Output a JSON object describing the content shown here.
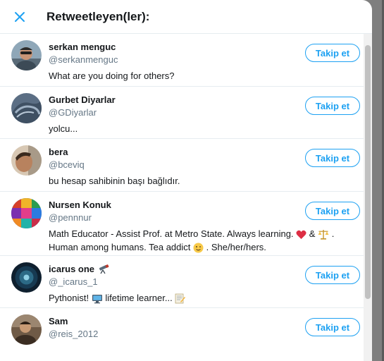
{
  "modal": {
    "title": "Retweetleyen(ler):",
    "close_icon": "close-icon",
    "accent_color": "#1da1f2"
  },
  "users": [
    {
      "name": "serkan menguc",
      "handle": "@serkanmenguc",
      "bio": "What are you doing for others?",
      "follow_label": "Takip et"
    },
    {
      "name": "Gurbet Diyarlar",
      "handle": "@GDiyarlar",
      "bio": "yolcu...",
      "follow_label": "Takip et"
    },
    {
      "name": "bera",
      "handle": "@bceviq",
      "bio": "bu hesap sahibinin başı bağlıdır.",
      "follow_label": "Takip et"
    },
    {
      "name": "Nursen Konuk",
      "handle": "@pennnur",
      "bio_line1_a": "Math Educator - Assist Prof. at Metro State. Always learning.",
      "bio_line1_b": "&",
      "bio_line1_c": ".",
      "bio_line2_a": "Human among humans. Tea addict",
      "bio_line2_b": ". She/her/hers.",
      "follow_label": "Takip et"
    },
    {
      "name": "icarus one",
      "handle": "@_icarus_1",
      "bio_a": "Pythonist!",
      "bio_b": "lifetime learner...",
      "follow_label": "Takip et"
    },
    {
      "name": "Sam",
      "handle": "@reis_2012",
      "follow_label": "Takip et"
    }
  ]
}
